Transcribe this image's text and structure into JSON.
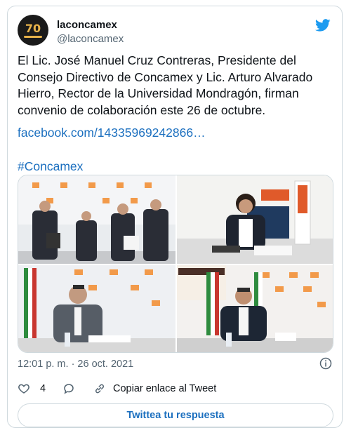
{
  "author": {
    "name": "laconcamex",
    "handle": "@laconcamex",
    "avatar_text": "70"
  },
  "tweet": {
    "text": "El Lic. José Manuel Cruz Contreras, Presidente del Consejo Directivo de Concamex y Lic. Arturo Alvarado Hierro, Rector de la Universidad Mondragón, firman convenio de colaboración este 26 de octubre.",
    "link": "facebook.com/14335969242866…",
    "hashtag": "#Concamex",
    "timestamp": "12:01 p. m. · 26 oct. 2021"
  },
  "media": {
    "photos": [
      {
        "icon": "group-signing-photo"
      },
      {
        "icon": "woman-signing-photo"
      },
      {
        "icon": "man-signing-photo"
      },
      {
        "icon": "man-signing-flags-photo"
      }
    ]
  },
  "actions": {
    "like_count": "4",
    "copy_link_label": "Copiar enlace al Tweet"
  },
  "reply_button": {
    "label": "Twittea tu respuesta"
  },
  "colors": {
    "accent": "#1d9bf0",
    "link": "#1b6fbf",
    "muted": "#536471",
    "border": "#cfd9de"
  }
}
